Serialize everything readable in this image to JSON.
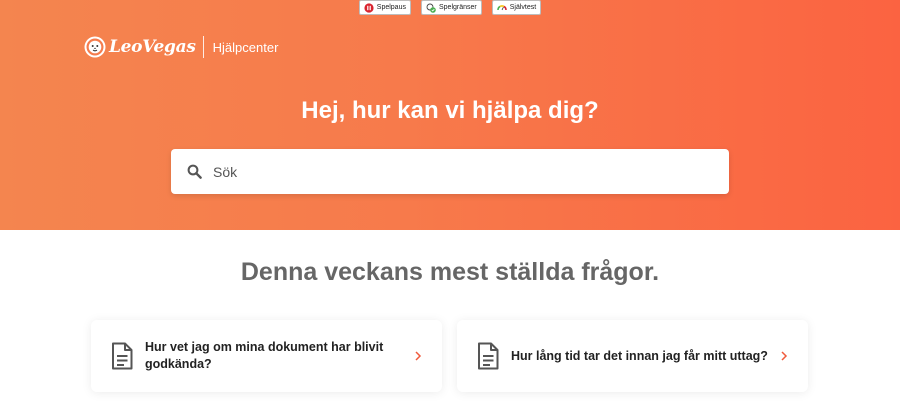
{
  "responsible_gaming": [
    {
      "label": "Spelpaus",
      "icon": "pause-icon"
    },
    {
      "label": "Spelgränser",
      "icon": "limits-icon"
    },
    {
      "label": "Självtest",
      "icon": "self-test-gauge-icon"
    }
  ],
  "header": {
    "logo_text": "LeoVegas",
    "helpcenter_label": "Hjälpcenter"
  },
  "hero": {
    "title": "Hej, hur kan vi hjälpa dig?"
  },
  "search": {
    "placeholder": "Sök"
  },
  "faq": {
    "section_title": "Denna veckans mest ställda frågor.",
    "items": [
      {
        "question": "Hur vet jag om mina dokument har blivit godkända?"
      },
      {
        "question": "Hur lång tid tar det innan jag får mitt uttag?"
      }
    ]
  },
  "colors": {
    "hero_start": "#f4854f",
    "hero_end": "#fb6341",
    "accent": "#f05a3c",
    "heading_gray": "#666666"
  }
}
